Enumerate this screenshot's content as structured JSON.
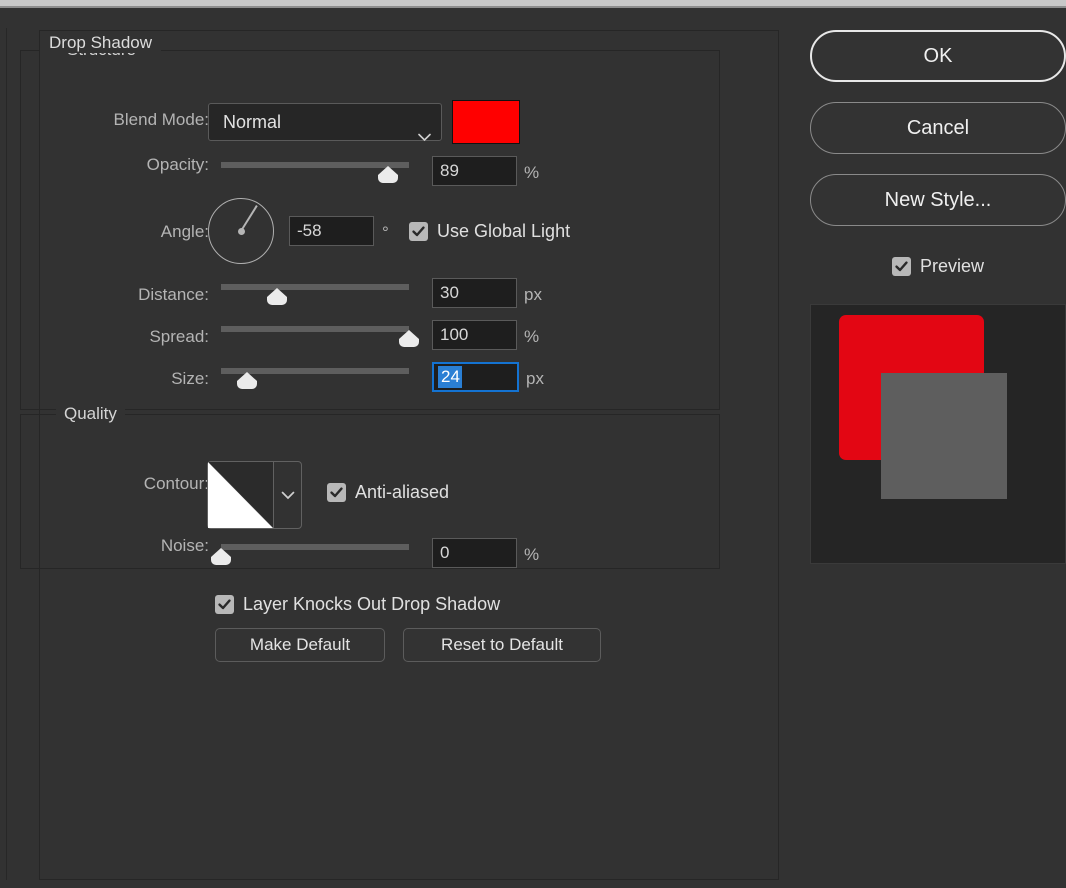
{
  "dialog": {
    "effect_title": "Drop Shadow"
  },
  "structure": {
    "legend": "Structure",
    "blend_mode": {
      "label": "Blend Mode:",
      "value": "Normal",
      "chevron_icon": "chevron-down-icon"
    },
    "color": {
      "hex": "#FF0000"
    },
    "opacity": {
      "label": "Opacity:",
      "value": "89",
      "unit": "%",
      "percent": 89
    },
    "angle": {
      "label": "Angle:",
      "value": "-58",
      "unit": "°",
      "degrees": -58
    },
    "use_global_light": {
      "label": "Use Global Light",
      "checked": true
    },
    "distance": {
      "label": "Distance:",
      "value": "30",
      "unit": "px",
      "percent": 30
    },
    "spread": {
      "label": "Spread:",
      "value": "100",
      "unit": "%",
      "percent": 100
    },
    "size": {
      "label": "Size:",
      "value": "24",
      "unit": "px",
      "percent": 14,
      "focused": true,
      "selected": true
    }
  },
  "quality": {
    "legend": "Quality",
    "contour": {
      "label": "Contour:",
      "chevron_icon": "chevron-down-icon"
    },
    "anti_aliased": {
      "label": "Anti-aliased",
      "checked": true
    },
    "noise": {
      "label": "Noise:",
      "value": "0",
      "unit": "%",
      "percent": 0
    }
  },
  "footer": {
    "layer_knocks_out": {
      "label": "Layer Knocks Out Drop Shadow",
      "checked": true
    },
    "make_default": "Make Default",
    "reset_to_default": "Reset to Default"
  },
  "actions": {
    "ok": "OK",
    "cancel": "Cancel",
    "new_style": "New Style...",
    "preview": {
      "label": "Preview",
      "checked": true
    }
  },
  "preview_thumbnail": {
    "shadow_color": "#E30613",
    "shape_color": "#5E5E5E"
  }
}
